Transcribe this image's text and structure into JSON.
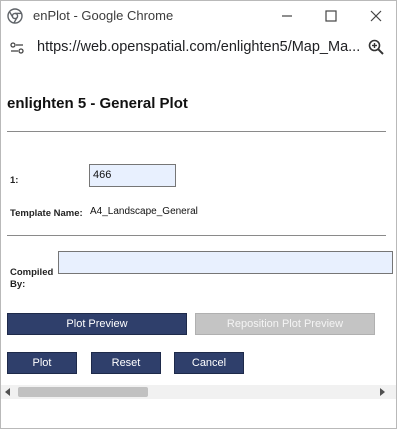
{
  "window": {
    "title": "enPlot - Google Chrome",
    "icons": {
      "app": "chrome-icon",
      "minimize": "minimize-icon",
      "maximize": "maximize-icon",
      "close": "close-icon"
    }
  },
  "address_bar": {
    "url": "https://web.openspatial.com/enlighten5/Map_Ma...",
    "icons": {
      "site_info": "site-info-icon",
      "zoom": "zoom-icon"
    }
  },
  "page": {
    "title": "enlighten 5 - General Plot",
    "fields": {
      "field_1_label": "1:",
      "field_1_value": "466",
      "template_label": "Template Name:",
      "template_value": "A4_Landscape_General",
      "compiled_by_label": "Compiled By:",
      "compiled_by_value": ""
    },
    "buttons": {
      "plot_preview": "Plot Preview",
      "reposition_plot_preview": "Reposition Plot Preview",
      "plot": "Plot",
      "reset": "Reset",
      "cancel": "Cancel"
    }
  },
  "colors": {
    "button_primary": "#2f3f6b",
    "button_disabled": "#c4c4c4",
    "input_background": "#e8f0fe"
  }
}
